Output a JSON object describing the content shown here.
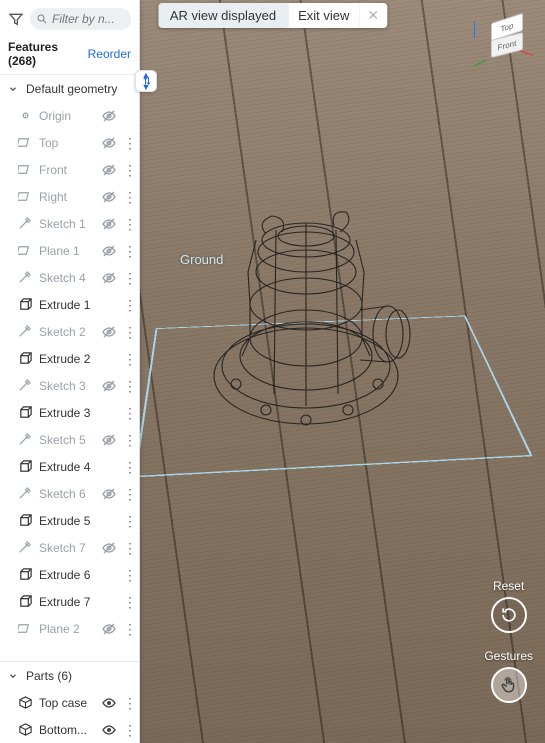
{
  "topbar": {
    "message": "AR view displayed",
    "exit_label": "Exit view",
    "close_glyph": "✕"
  },
  "viewcube": {
    "top": "Top",
    "front": "Front"
  },
  "ground_label": "Ground",
  "actions": {
    "reset_label": "Reset",
    "gestures_label": "Gestures"
  },
  "sidebar": {
    "search_placeholder": "Filter by n...",
    "header_label": "Features",
    "header_count": "(268)",
    "reorder_label": "Reorder",
    "default_geometry_label": "Default geometry",
    "parts_label": "Parts",
    "parts_count": "(6)"
  },
  "items": [
    {
      "icon": "origin",
      "label": "Origin",
      "dim": true,
      "eye": "hidden",
      "dots": false
    },
    {
      "icon": "plane",
      "label": "Top",
      "dim": true,
      "eye": "hidden",
      "dots": true
    },
    {
      "icon": "plane",
      "label": "Front",
      "dim": true,
      "eye": "hidden",
      "dots": true
    },
    {
      "icon": "plane",
      "label": "Right",
      "dim": true,
      "eye": "hidden",
      "dots": true
    },
    {
      "icon": "sketch",
      "label": "Sketch 1",
      "dim": true,
      "eye": "hidden",
      "dots": true
    },
    {
      "icon": "plane",
      "label": "Plane 1",
      "dim": true,
      "eye": "hidden",
      "dots": true
    },
    {
      "icon": "sketch",
      "label": "Sketch 4",
      "dim": true,
      "eye": "hidden",
      "dots": true
    },
    {
      "icon": "extrude",
      "label": "Extrude 1",
      "dim": false,
      "eye": "none",
      "dots": true
    },
    {
      "icon": "sketch",
      "label": "Sketch 2",
      "dim": true,
      "eye": "hidden",
      "dots": true
    },
    {
      "icon": "extrude",
      "label": "Extrude 2",
      "dim": false,
      "eye": "none",
      "dots": true
    },
    {
      "icon": "sketch",
      "label": "Sketch 3",
      "dim": true,
      "eye": "hidden",
      "dots": true
    },
    {
      "icon": "extrude",
      "label": "Extrude 3",
      "dim": false,
      "eye": "none",
      "dots": true
    },
    {
      "icon": "sketch",
      "label": "Sketch 5",
      "dim": true,
      "eye": "hidden",
      "dots": true
    },
    {
      "icon": "extrude",
      "label": "Extrude 4",
      "dim": false,
      "eye": "none",
      "dots": true
    },
    {
      "icon": "sketch",
      "label": "Sketch 6",
      "dim": true,
      "eye": "hidden",
      "dots": true
    },
    {
      "icon": "extrude",
      "label": "Extrude 5",
      "dim": false,
      "eye": "none",
      "dots": true
    },
    {
      "icon": "sketch",
      "label": "Sketch 7",
      "dim": true,
      "eye": "hidden",
      "dots": true
    },
    {
      "icon": "extrude",
      "label": "Extrude 6",
      "dim": false,
      "eye": "none",
      "dots": true
    },
    {
      "icon": "extrude",
      "label": "Extrude 7",
      "dim": false,
      "eye": "none",
      "dots": true
    },
    {
      "icon": "plane",
      "label": "Plane 2",
      "dim": true,
      "eye": "hidden",
      "dots": true
    }
  ],
  "parts": [
    {
      "icon": "part",
      "label": "Top case",
      "eye": "visible"
    },
    {
      "icon": "part",
      "label": "Bottom...",
      "eye": "visible"
    }
  ]
}
